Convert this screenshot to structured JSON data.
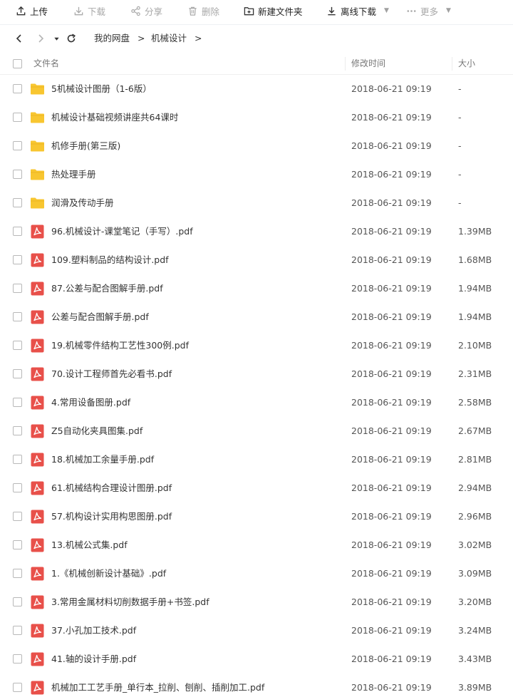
{
  "toolbar": {
    "upload": "上传",
    "download": "下载",
    "share": "分享",
    "delete": "删除",
    "new_folder": "新建文件夹",
    "offline_download": "离线下载",
    "more": "更多"
  },
  "nav": {
    "breadcrumb": [
      "我的网盘",
      "机械设计"
    ],
    "separator": ">"
  },
  "table": {
    "headers": {
      "name": "文件名",
      "modified": "修改时间",
      "size": "大小"
    },
    "rows": [
      {
        "type": "folder",
        "name": "5机械设计图册（1-6版）",
        "modified": "2018-06-21 09:19",
        "size": "-"
      },
      {
        "type": "folder",
        "name": "机械设计基础视频讲座共64课时",
        "modified": "2018-06-21 09:19",
        "size": "-"
      },
      {
        "type": "folder",
        "name": "机修手册(第三版)",
        "modified": "2018-06-21 09:19",
        "size": "-"
      },
      {
        "type": "folder",
        "name": "热处理手册",
        "modified": "2018-06-21 09:19",
        "size": "-"
      },
      {
        "type": "folder",
        "name": "润滑及传动手册",
        "modified": "2018-06-21 09:19",
        "size": "-"
      },
      {
        "type": "pdf",
        "name": "96.机械设计-课堂笔记（手写）.pdf",
        "modified": "2018-06-21 09:19",
        "size": "1.39MB"
      },
      {
        "type": "pdf",
        "name": "109.塑料制品的结构设计.pdf",
        "modified": "2018-06-21 09:19",
        "size": "1.68MB"
      },
      {
        "type": "pdf",
        "name": "87.公差与配合图解手册.pdf",
        "modified": "2018-06-21 09:19",
        "size": "1.94MB"
      },
      {
        "type": "pdf",
        "name": "公差与配合图解手册.pdf",
        "modified": "2018-06-21 09:19",
        "size": "1.94MB"
      },
      {
        "type": "pdf",
        "name": "19.机械零件结构工艺性300例.pdf",
        "modified": "2018-06-21 09:19",
        "size": "2.10MB"
      },
      {
        "type": "pdf",
        "name": "70.设计工程师首先必看书.pdf",
        "modified": "2018-06-21 09:19",
        "size": "2.31MB"
      },
      {
        "type": "pdf",
        "name": "4.常用设备图册.pdf",
        "modified": "2018-06-21 09:19",
        "size": "2.58MB"
      },
      {
        "type": "pdf",
        "name": "Z5自动化夹具图集.pdf",
        "modified": "2018-06-21 09:19",
        "size": "2.67MB"
      },
      {
        "type": "pdf",
        "name": "18.机械加工余量手册.pdf",
        "modified": "2018-06-21 09:19",
        "size": "2.81MB"
      },
      {
        "type": "pdf",
        "name": "61.机械结构合理设计图册.pdf",
        "modified": "2018-06-21 09:19",
        "size": "2.94MB"
      },
      {
        "type": "pdf",
        "name": "57.机构设计实用构思图册.pdf",
        "modified": "2018-06-21 09:19",
        "size": "2.96MB"
      },
      {
        "type": "pdf",
        "name": "13.机械公式集.pdf",
        "modified": "2018-06-21 09:19",
        "size": "3.02MB"
      },
      {
        "type": "pdf",
        "name": "1.《机械创新设计基础》.pdf",
        "modified": "2018-06-21 09:19",
        "size": "3.09MB"
      },
      {
        "type": "pdf",
        "name": "3.常用金属材料切削数据手册+书签.pdf",
        "modified": "2018-06-21 09:19",
        "size": "3.20MB"
      },
      {
        "type": "pdf",
        "name": "37.小孔加工技术.pdf",
        "modified": "2018-06-21 09:19",
        "size": "3.24MB"
      },
      {
        "type": "pdf",
        "name": "41.轴的设计手册.pdf",
        "modified": "2018-06-21 09:19",
        "size": "3.43MB"
      },
      {
        "type": "pdf",
        "name": "机械加工工艺手册_单行本_拉削、刨削、插削加工.pdf",
        "modified": "2018-06-21 09:19",
        "size": "3.89MB"
      }
    ]
  },
  "colors": {
    "folder": "#F8C630",
    "pdf": "#E8504A",
    "disabled_text": "#A8A8A8"
  }
}
